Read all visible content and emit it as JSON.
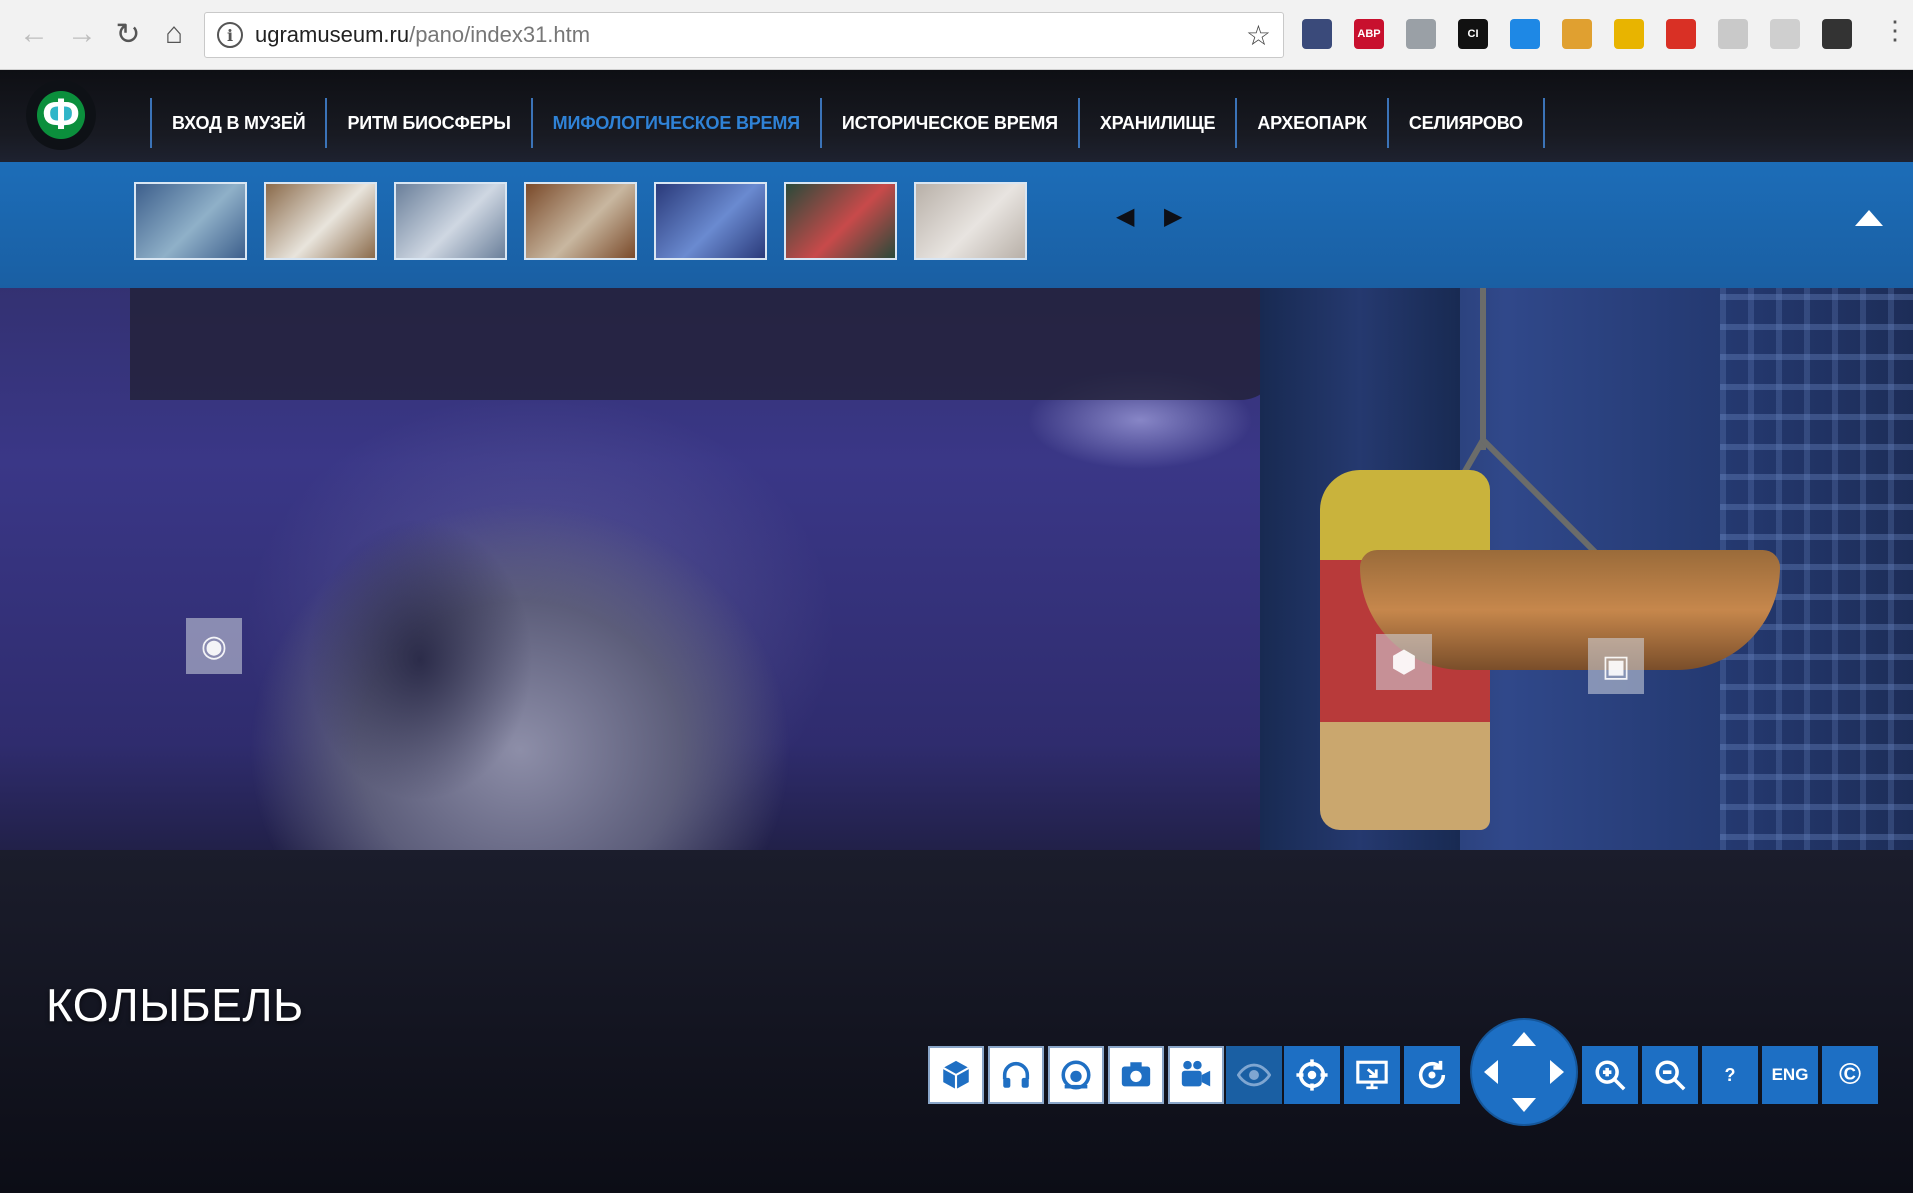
{
  "browser": {
    "url_host": "ugramuseum.ru",
    "url_path": "/pano/index31.htm",
    "extensions": [
      {
        "name": "screenshot-ext-icon",
        "label": "",
        "color": "#3a4a7a"
      },
      {
        "name": "adblock-plus-icon",
        "label": "ABP",
        "color": "#c8102e"
      },
      {
        "name": "shield-ext-icon",
        "label": "",
        "color": "#9aa0a6"
      },
      {
        "name": "ci-ext-icon",
        "label": "CI",
        "color": "#111111"
      },
      {
        "name": "cloud-ext-icon",
        "label": "",
        "color": "#1e88e5"
      },
      {
        "name": "face-ext-icon",
        "label": "",
        "color": "#e0a030"
      },
      {
        "name": "bookmark-ext-icon",
        "label": "",
        "color": "#e8b400"
      },
      {
        "name": "red-book-ext-icon",
        "label": "",
        "color": "#d93025"
      },
      {
        "name": "gray-doc-ext-icon",
        "label": "",
        "color": "#c9c9c9"
      },
      {
        "name": "gear-ext-icon",
        "label": "",
        "color": "#cfcfcf"
      },
      {
        "name": "user-block-ext-icon",
        "label": "",
        "color": "#333333"
      }
    ]
  },
  "site": {
    "logo_glyph": "Ф",
    "menu": [
      {
        "label": "ВХОД В МУЗЕЙ",
        "active": false
      },
      {
        "label": "РИТМ БИОСФЕРЫ",
        "active": false
      },
      {
        "label": "МИФОЛОГИЧЕСКОЕ ВРЕМЯ",
        "active": true
      },
      {
        "label": "ИСТОРИЧЕСКОЕ ВРЕМЯ",
        "active": false
      },
      {
        "label": "ХРАНИЛИЩЕ",
        "active": false
      },
      {
        "label": "АРХЕОПАРК",
        "active": false
      },
      {
        "label": "СЕЛИЯРОВО",
        "active": false
      }
    ],
    "thumbnails": [
      {
        "colors": [
          "#3d5f8c",
          "#8fb0c8"
        ]
      },
      {
        "colors": [
          "#8a6a4a",
          "#e8e4dc"
        ]
      },
      {
        "colors": [
          "#6a7f9a",
          "#cfd7e2"
        ]
      },
      {
        "colors": [
          "#7a4a2a",
          "#c8b7a0"
        ]
      },
      {
        "colors": [
          "#2a3a7a",
          "#6a8ad0"
        ]
      },
      {
        "colors": [
          "#2a4a3a",
          "#c84a4a"
        ]
      },
      {
        "colors": [
          "#b8b0a8",
          "#e8e4e0"
        ]
      }
    ]
  },
  "scene": {
    "title": "КОЛЫБЕЛЬ"
  },
  "toolbar": {
    "eng_label": "ENG",
    "help_label": "?",
    "copyright_label": "©"
  }
}
